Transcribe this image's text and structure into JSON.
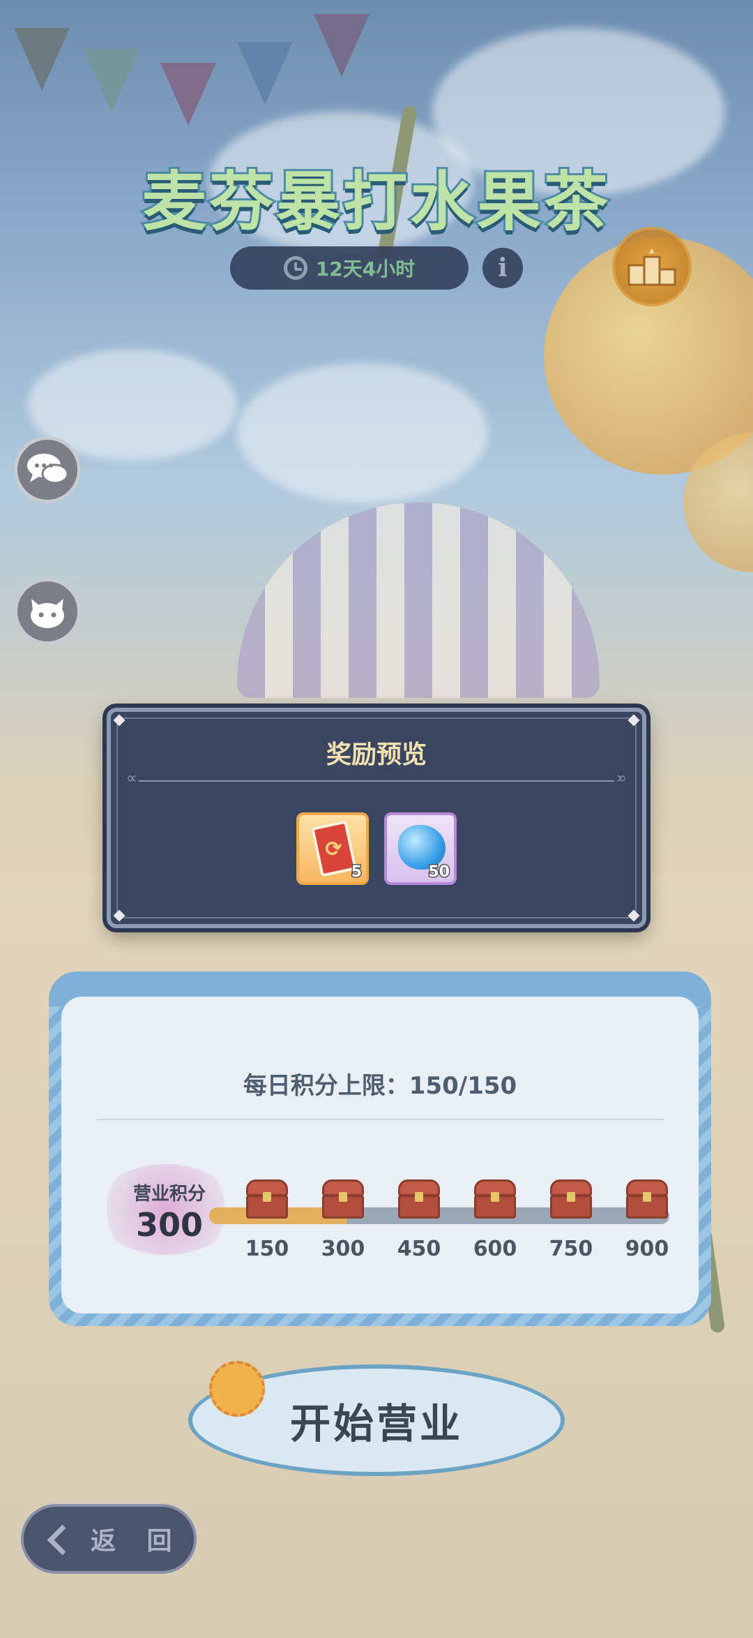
{
  "event": {
    "title": "麦芬暴打水果茶",
    "timer": "12天4小时"
  },
  "modal": {
    "title": "奖励预览",
    "rewards": [
      {
        "name": "card",
        "quantity": "5",
        "frame_color": "#f2a64a"
      },
      {
        "name": "blue-gem",
        "quantity": "50",
        "frame_color": "#b58ad8"
      }
    ]
  },
  "panel": {
    "daily_limit": "每日积分上限：150/150",
    "score_label": "营业积分",
    "score_value": "300",
    "milestones": [
      "150",
      "300",
      "450",
      "600",
      "750",
      "900"
    ]
  },
  "buttons": {
    "start": "开始营业",
    "back": "返 回"
  },
  "colors": {
    "accent": "#f3e1b2",
    "modal_bg": "#3a4560",
    "progress_fill": "#e2b05e"
  }
}
